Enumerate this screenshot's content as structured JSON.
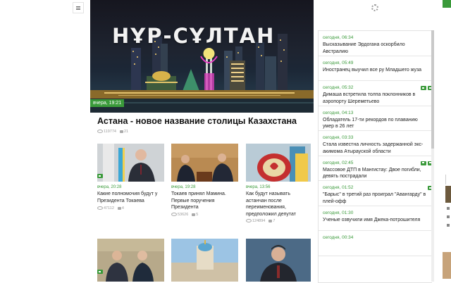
{
  "hero": {
    "overlay_title": "НҰР-СҰЛТАН",
    "time": "вчера, 19:21",
    "headline": "Астана - новое название столицы Казахстана",
    "views": "119774",
    "comments": "21"
  },
  "cards": [
    {
      "time": "вчера, 20:28",
      "title": "Какие полномочия будут у Президента Токаева",
      "views": "47112",
      "comments": "4"
    },
    {
      "time": "вчера, 19:28",
      "title": "Токаев принял Мамина. Первые поручения Президента",
      "views": "53626",
      "comments": "5"
    },
    {
      "time": "вчера, 13:56",
      "title": "Как будут называть астанчан после переименования, предположил депутат",
      "views": "124894",
      "comments": "7"
    }
  ],
  "feed": [
    {
      "time": "сегодня, 06:34",
      "text": "Высказывание Эрдогана оскорбило Австралию",
      "media": false
    },
    {
      "time": "сегодня, 05:49",
      "text": "Иностранец выучил все ру Младшего жуза",
      "media": false
    },
    {
      "time": "сегодня, 05:32",
      "text": "Димаша встретила толпа поклонников в аэропорту Шереметьево",
      "media": true
    },
    {
      "time": "сегодня, 04:13",
      "text": "Обладатель 17-ти рекордов по плаванию умер в 26 лет",
      "media": false
    },
    {
      "time": "сегодня, 03:33",
      "text": "Стала известна личность задержанной экс-акимома Атырауской области",
      "media": false
    },
    {
      "time": "сегодня, 02:45",
      "text": "Массовое ДТП в Мангистау: Двое погибли, девять пострадали",
      "media": true
    },
    {
      "time": "сегодня, 01:52",
      "text": "\"Барыс\" в третий раз проиграл \"Авангарду\" в плей-офф",
      "media": true
    },
    {
      "time": "сегодня, 01:30",
      "text": "Ученые озвучили имя Джека-потрошителя",
      "media": false
    },
    {
      "time": "сегодня, 00:34",
      "text": "",
      "media": false
    }
  ],
  "colors": {
    "accent": "#3a9a3a",
    "border": "#e2e2e2"
  },
  "icons": {
    "menu": "hamburger-icon",
    "loading": "spinner-icon",
    "views": "eye-icon",
    "comments": "comment-icon",
    "media": "camera-icon"
  }
}
